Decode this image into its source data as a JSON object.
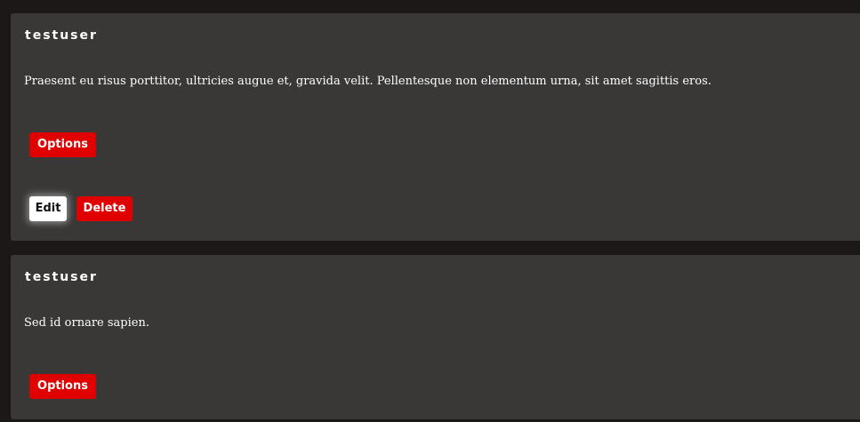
{
  "posts": [
    {
      "username": "testuser",
      "body": "Praesent eu risus porttitor, ultricies augue et, gravida velit. Pellentesque non elementum urna, sit amet sagittis eros.",
      "options_label": "Options",
      "edit_label": "Edit",
      "delete_label": "Delete"
    },
    {
      "username": "testuser",
      "body": "Sed id ornare sapien.",
      "options_label": "Options"
    }
  ],
  "colors": {
    "page_background": "#1c1817",
    "card_background": "#393837",
    "accent_red": "#e00000",
    "text": "#ffffff"
  }
}
